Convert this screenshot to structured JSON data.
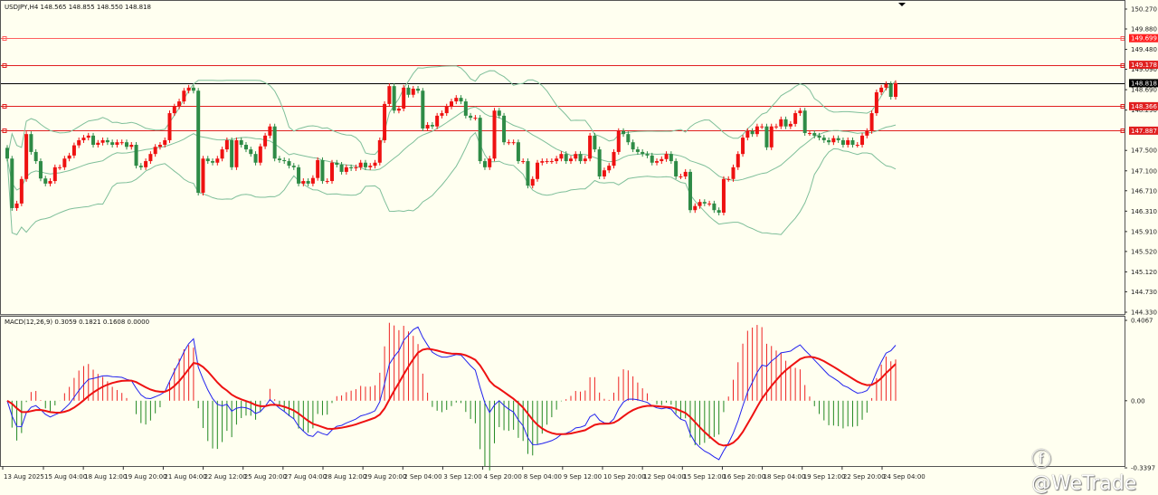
{
  "chart_data": {
    "type": "candlestick",
    "symbol_header": "USDJPY,H4  148.565 148.855 148.550 148.818",
    "timeframe": "H4",
    "price_axis": {
      "ticks": [
        "150.270",
        "149.880",
        "149.480",
        "149.090",
        "148.690",
        "148.290",
        "147.500",
        "147.100",
        "146.710",
        "146.310",
        "145.910",
        "145.520",
        "145.120",
        "144.730",
        "144.330"
      ],
      "range": [
        144.33,
        150.27
      ]
    },
    "time_axis_labels": [
      "13 Aug 2025",
      "15 Aug 04:00",
      "18 Aug 12:00",
      "19 Aug 20:00",
      "21 Aug 04:00",
      "22 Aug 12:00",
      "25 Aug 20:00",
      "27 Aug 04:00",
      "28 Aug 12:00",
      "29 Aug 20:00",
      "2 Sep 04:00",
      "3 Sep 12:00",
      "4 Sep 20:00",
      "8 Sep 04:00",
      "9 Sep 12:00",
      "10 Sep 20:00",
      "12 Sep 04:00",
      "15 Sep 12:00",
      "16 Sep 20:00",
      "18 Sep 04:00",
      "19 Sep 12:00",
      "22 Sep 20:00",
      "24 Sep 04:00"
    ],
    "closes": [
      147.34,
      146.37,
      146.46,
      146.94,
      147.82,
      147.47,
      147.29,
      146.95,
      146.85,
      146.9,
      147.17,
      147.17,
      147.34,
      147.4,
      147.6,
      147.7,
      147.75,
      147.79,
      147.61,
      147.65,
      147.7,
      147.66,
      147.61,
      147.66,
      147.66,
      147.57,
      147.61,
      147.2,
      147.17,
      147.29,
      147.43,
      147.57,
      147.61,
      147.7,
      148.23,
      148.36,
      148.46,
      148.67,
      148.73,
      148.67,
      146.67,
      147.34,
      147.29,
      147.26,
      147.34,
      147.52,
      147.7,
      147.17,
      147.7,
      147.61,
      147.52,
      147.43,
      147.26,
      147.58,
      147.79,
      147.97,
      147.34,
      147.31,
      147.29,
      147.2,
      147.17,
      146.85,
      146.9,
      146.85,
      146.96,
      147.31,
      146.9,
      146.9,
      147.26,
      147.22,
      147.08,
      147.17,
      147.15,
      147.17,
      147.26,
      147.17,
      147.2,
      147.26,
      147.7,
      148.41,
      148.76,
      148.28,
      148.32,
      148.73,
      148.59,
      148.71,
      148.67,
      147.93,
      148.0,
      147.97,
      148.18,
      148.23,
      148.36,
      148.46,
      148.53,
      148.46,
      148.18,
      148.14,
      148.14,
      147.29,
      147.17,
      147.34,
      148.28,
      148.18,
      147.66,
      147.66,
      147.66,
      147.29,
      147.29,
      146.81,
      146.94,
      147.26,
      147.29,
      147.29,
      147.29,
      147.34,
      147.43,
      147.29,
      147.34,
      147.43,
      147.29,
      147.34,
      147.79,
      147.52,
      146.99,
      147.11,
      147.2,
      147.47,
      147.88,
      147.82,
      147.66,
      147.52,
      147.47,
      147.43,
      147.4,
      147.26,
      147.29,
      147.33,
      147.43,
      147.29,
      146.99,
      146.99,
      147.08,
      146.33,
      146.41,
      146.49,
      146.46,
      146.46,
      146.33,
      146.28,
      146.94,
      146.94,
      147.17,
      147.43,
      147.75,
      147.88,
      147.82,
      147.97,
      147.97,
      147.56,
      147.97,
      147.97,
      148.11,
      147.97,
      148.02,
      148.23,
      148.28,
      147.84,
      147.84,
      147.79,
      147.75,
      147.7,
      147.66,
      147.74,
      147.7,
      147.61,
      147.7,
      147.61,
      147.61,
      147.79,
      147.88,
      148.23,
      148.64,
      148.73,
      148.8,
      148.55,
      148.82
    ],
    "first_open": 147.55,
    "horizontal_lines": [
      {
        "price": 149.699,
        "label": "149.699",
        "color": "#ff6060"
      },
      {
        "price": 149.178,
        "label": "149.178",
        "color": "#e02020"
      },
      {
        "price": 148.818,
        "label": "148.818",
        "color": "#000000"
      },
      {
        "price": 148.366,
        "label": "148.366",
        "color": "#e02020"
      },
      {
        "price": 147.887,
        "label": "147.887",
        "color": "#e02020"
      }
    ],
    "indicators": {
      "bollinger": {
        "period": 20,
        "deviation": 2,
        "color": "#7fbf9a"
      },
      "macd": {
        "header": "MACD(12,26,9) 0.3059 0.1821 0.1608 0.0000",
        "fast": 12,
        "slow": 26,
        "signal": 9,
        "axis_ticks": [
          "0.4067",
          "0.00",
          "-0.3397"
        ],
        "range": [
          -0.3397,
          0.4067
        ],
        "macd_color": "#2222ee",
        "signal_color": "#ee1111",
        "hist_up_color": "#ee2222",
        "hist_down_color": "#228822"
      }
    },
    "colors": {
      "background": "#fffff0",
      "bull": "#ee1111",
      "bear": "#2e8b46",
      "grid_frame": "#555555"
    }
  },
  "watermark": "@WeTrade"
}
